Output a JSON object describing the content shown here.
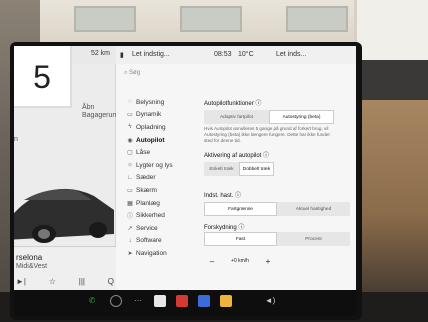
{
  "badge": {
    "number": "5"
  },
  "car": {
    "range": "52 km",
    "trunk_open_line1": "Åbn",
    "trunk_open_line2": "Bagagerum",
    "frunk_label": "n",
    "media_title": "rselona",
    "media_subtitle": "Midi&Vest",
    "media_controls": [
      "►|",
      "☆",
      "|||",
      "Q"
    ]
  },
  "status_bar": {
    "lock_label": "▮",
    "profile": "Let indstig...",
    "time": "08:53",
    "temperature": "10°C",
    "profile2": "Let inds..."
  },
  "search": {
    "placeholder": "Søg"
  },
  "nav": [
    {
      "icon": "light-bulb",
      "label": "Belysning",
      "active": false
    },
    {
      "icon": "car",
      "label": "Dynamik",
      "active": false
    },
    {
      "icon": "bolt",
      "label": "Opladning",
      "active": false
    },
    {
      "icon": "steering-wheel",
      "label": "Autopilot",
      "active": true
    },
    {
      "icon": "lock",
      "label": "Låse",
      "active": false
    },
    {
      "icon": "sun",
      "label": "Lygter og lys",
      "active": false
    },
    {
      "icon": "seat",
      "label": "Sæder",
      "active": false
    },
    {
      "icon": "screen",
      "label": "Skærm",
      "active": false
    },
    {
      "icon": "calendar",
      "label": "Planlæg",
      "active": false
    },
    {
      "icon": "shield",
      "label": "Sikkerhed",
      "active": false
    },
    {
      "icon": "wrench",
      "label": "Service",
      "active": false
    },
    {
      "icon": "download",
      "label": "Software",
      "active": false
    },
    {
      "icon": "navigation",
      "label": "Navigation",
      "active": false
    }
  ],
  "content": {
    "autopilot_title": "Autopilotfunktioner",
    "autopilot_options": [
      "Adaptiv fartpilot",
      "Autostyring (beta)"
    ],
    "autopilot_note": "Hvis Autopilot annulleres 5 gange på grund af forkert brug, vil Autostyring (beta) ikke længere fungere. Dette har ikke fundet sted for denne tid.",
    "activation_title": "Aktivering af autopilot",
    "activation_options": [
      "Enkelt træk",
      "Dobbelt træk"
    ],
    "speed_title": "Indst. hast.",
    "speed_options": [
      "Fartgrænse",
      "Aktuel hastighed"
    ],
    "offset_title": "Forskydning",
    "offset_options": [
      "Fast",
      "Procent"
    ],
    "stepper_minus": "–",
    "stepper_value": "+0 km/h",
    "stepper_plus": "+"
  },
  "colors": {
    "taskbar_green": "#2faa3a",
    "taskbar_red": "#d23a32"
  }
}
